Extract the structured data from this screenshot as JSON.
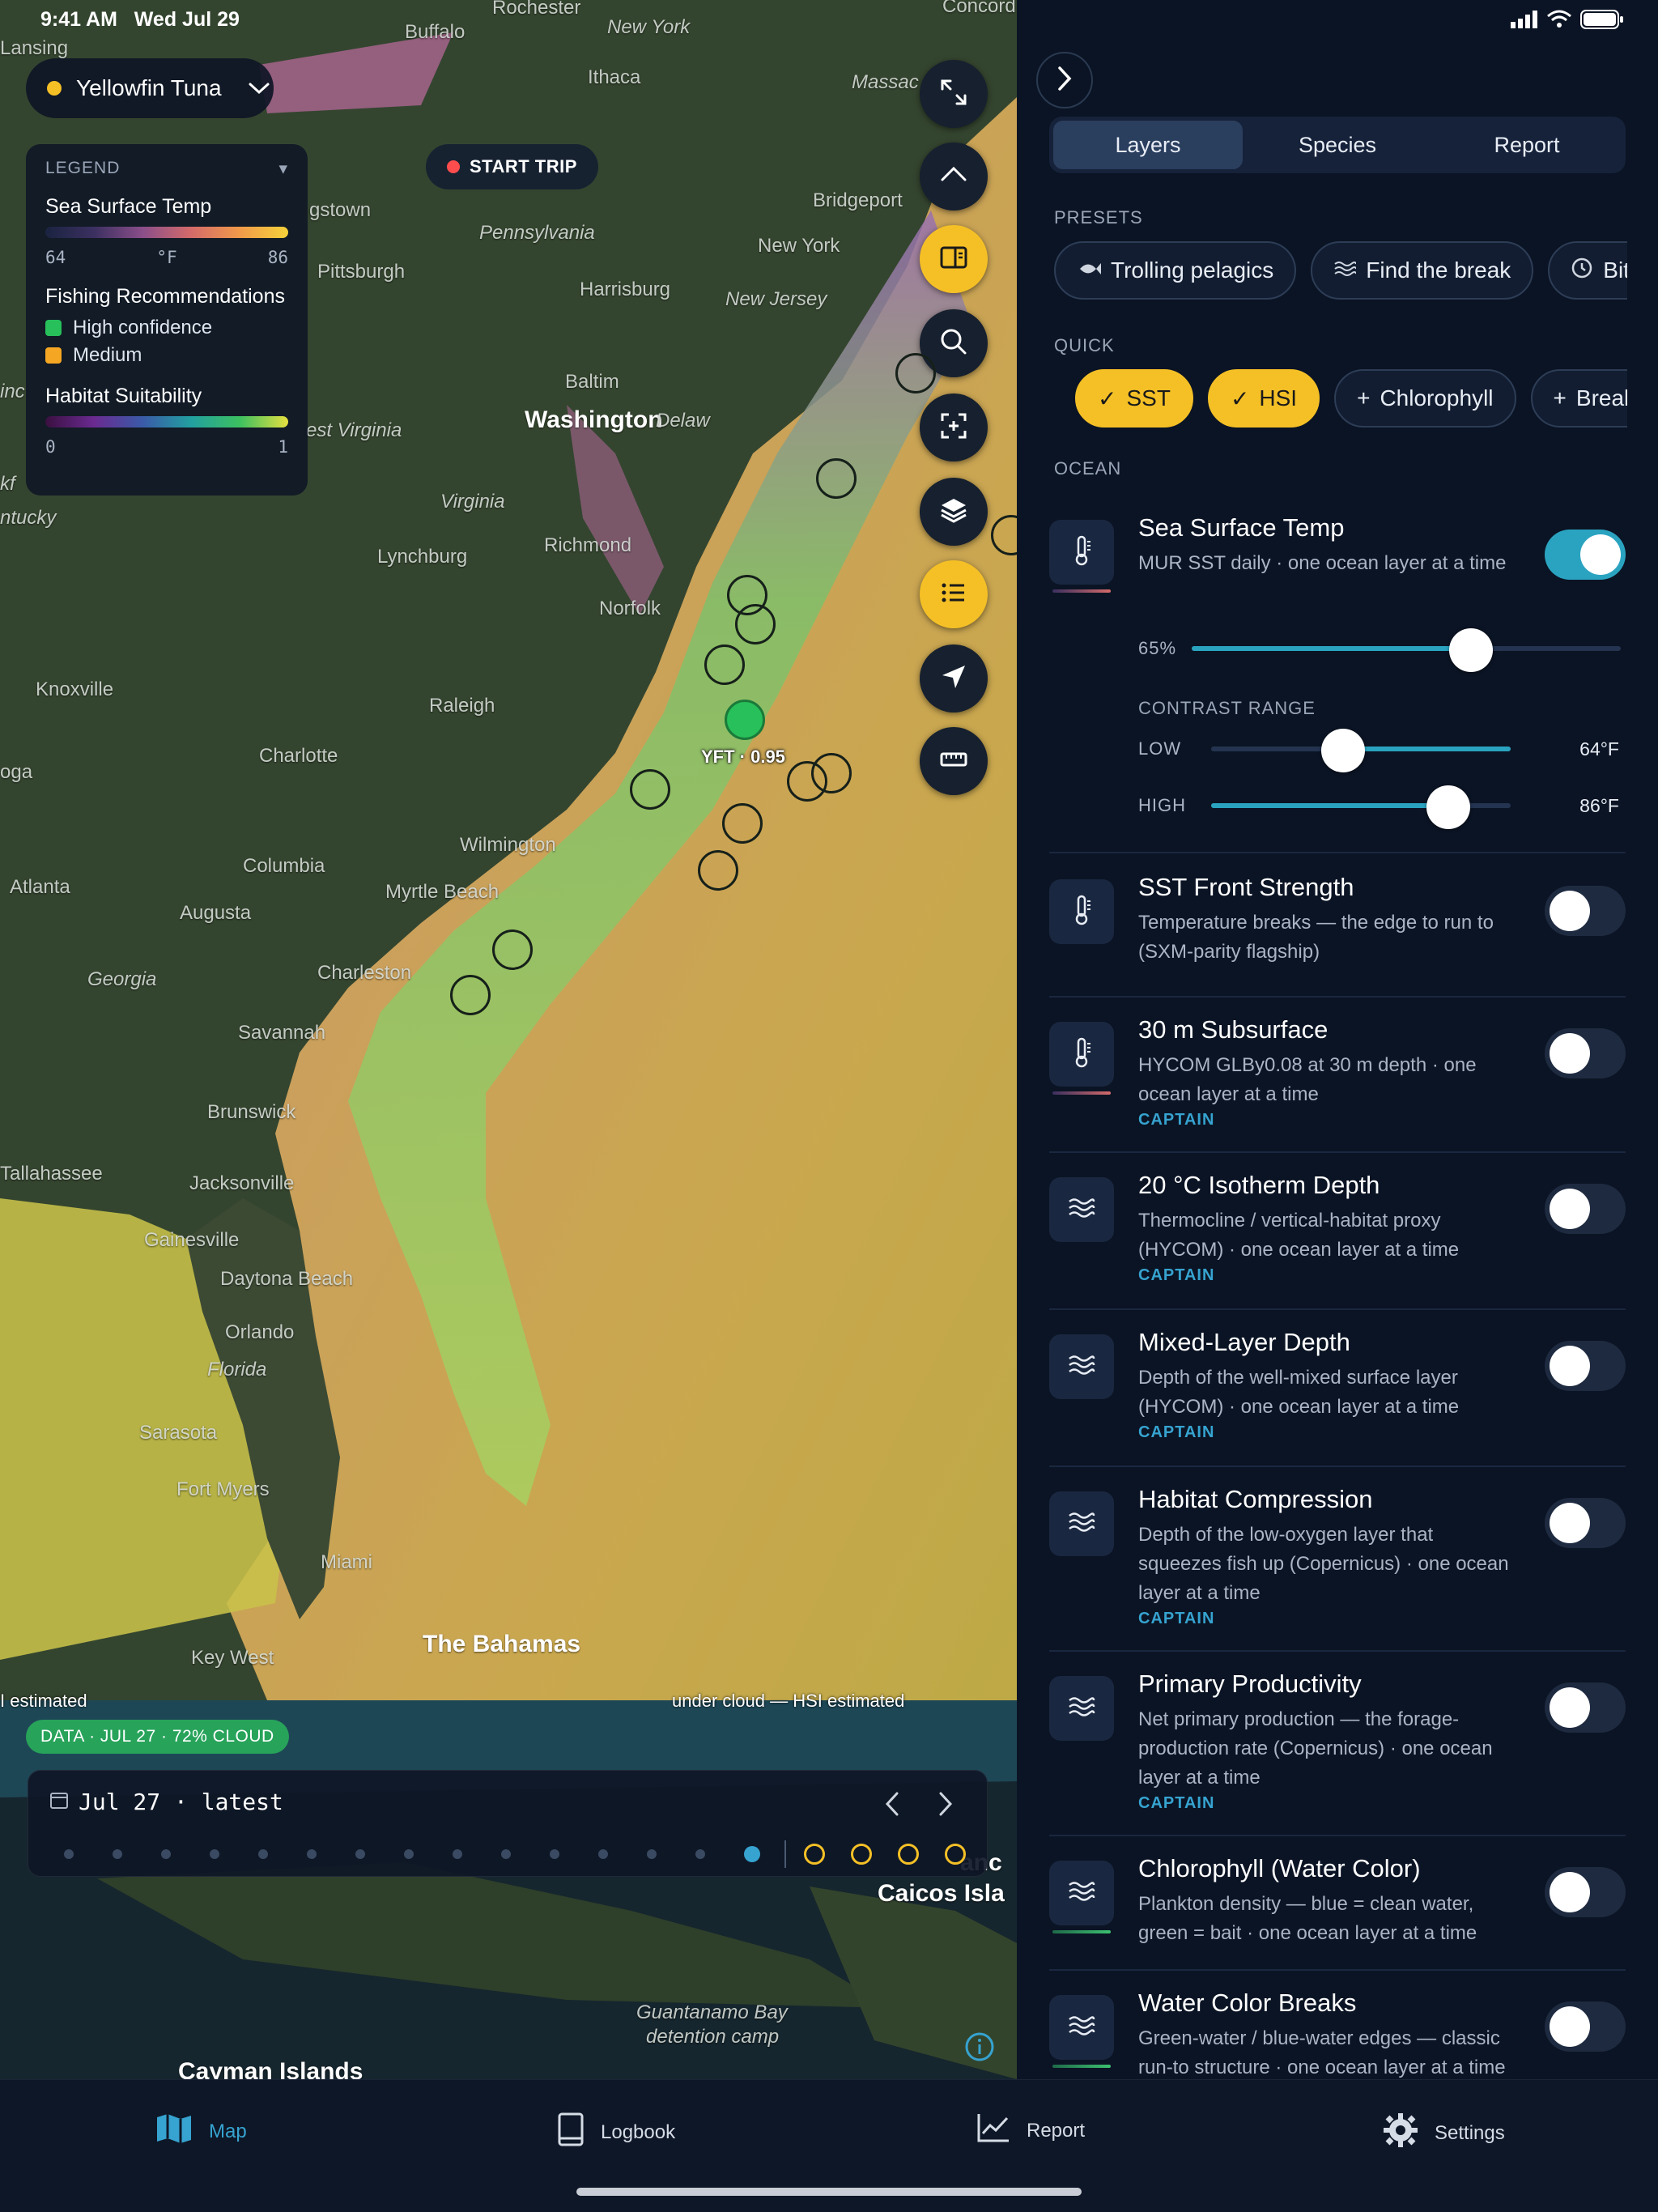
{
  "status_bar": {
    "time": "9:41 AM",
    "date": "Wed Jul 29"
  },
  "map": {
    "species_selector": {
      "label": "Yellowfin Tuna",
      "dot_color": "#f5c026"
    },
    "start_trip_label": "START TRIP",
    "legend": {
      "title": "LEGEND",
      "sst": {
        "heading": "Sea Surface Temp",
        "min": "64",
        "unit": "°F",
        "max": "86"
      },
      "recommendations": {
        "heading": "Fishing Recommendations",
        "high": "High confidence",
        "medium": "Medium",
        "high_color": "#27c05a",
        "medium_color": "#f5a623"
      },
      "habitat": {
        "heading": "Habitat Suitability",
        "min": "0",
        "max": "1"
      }
    },
    "place_labels": {
      "rochester": "Rochester",
      "buffalo": "Buffalo",
      "new_york": "New York",
      "concord": "Concord",
      "lansing": "Lansing",
      "ithaca": "Ithaca",
      "massachusetts": "Massac",
      "gstown": "gstown",
      "pennsylvania": "Pennsylvania",
      "bridgeport": "Bridgeport",
      "pittsburgh": "Pittsburgh",
      "harrisburg": "Harrisburg",
      "new_york_city": "New York",
      "new_jersey": "New Jersey",
      "baltimore": "Baltim",
      "washington": "Washington",
      "delaware": "Delaw",
      "west_virginia": "est Virginia",
      "kf": "kf",
      "virginia": "Virginia",
      "richmond": "Richmond",
      "lynchburg": "Lynchburg",
      "ntucky": "ntucky",
      "norfolk": "Norfolk",
      "knoxville": "Knoxville",
      "raleigh": "Raleigh",
      "charlotte": "Charlotte",
      "oga": "oga",
      "wilmington": "Wilmington",
      "columbia": "Columbia",
      "atlanta": "Atlanta",
      "myrtle_beach": "Myrtle Beach",
      "augusta": "Augusta",
      "georgia": "Georgia",
      "charleston": "Charleston",
      "savannah": "Savannah",
      "brunswick": "Brunswick",
      "tallahassee": "Tallahassee",
      "jacksonville": "Jacksonville",
      "gainesville": "Gainesville",
      "daytona_beach": "Daytona Beach",
      "orlando": "Orlando",
      "florida": "Florida",
      "sarasota": "Sarasota",
      "fort_myers": "Fort Myers",
      "miami": "Miami",
      "key_west": "Key West",
      "bahamas": "The Bahamas",
      "caicos": "Caicos Isla",
      "turks": "anc",
      "guantanamo": "Guantanamo Bay",
      "detention": "detention camp",
      "cayman": "Cayman Islands",
      "inc": "inc"
    },
    "marker_label": "YFT · 0.95",
    "attribution_left": "I estimated",
    "attribution_right": "under cloud — HSI estimated",
    "data_badge": "DATA · JUL 27 · 72% CLOUD",
    "timeline": {
      "date_label": "Jul 27 · latest",
      "past_days": 14,
      "forecast_days": 4
    }
  },
  "panel": {
    "tabs": [
      {
        "label": "Layers",
        "active": true
      },
      {
        "label": "Species",
        "active": false
      },
      {
        "label": "Report",
        "active": false
      }
    ],
    "presets": {
      "heading": "PRESETS",
      "items": [
        {
          "label": "Trolling pelagics",
          "icon": "fish-icon"
        },
        {
          "label": "Find the break",
          "icon": "waves-icon"
        },
        {
          "label": "Bite t",
          "icon": "clock-icon"
        }
      ]
    },
    "quick": {
      "heading": "QUICK",
      "items": [
        {
          "label": "SST",
          "on": true
        },
        {
          "label": "HSI",
          "on": true
        },
        {
          "label": "Chlorophyll",
          "on": false
        },
        {
          "label": "Breaks",
          "on": false
        }
      ]
    },
    "ocean": {
      "heading": "OCEAN",
      "sst": {
        "title": "Sea Surface Temp",
        "desc": "MUR SST daily  ·  one ocean layer at a time",
        "on": true,
        "opacity_label": "65%",
        "opacity": 0.65,
        "contrast_heading": "CONTRAST RANGE",
        "low_label": "LOW",
        "low_value": "64°F",
        "high_label": "HIGH",
        "high_value": "86°F"
      },
      "layers": [
        {
          "title": "SST Front Strength",
          "desc": "Temperature breaks — the edge to run to (SXM-parity flagship)",
          "cap": "",
          "icon": "thermometer-icon",
          "on": false
        },
        {
          "title": "30 m Subsurface",
          "desc": "HYCOM GLBy0.08 at 30 m depth  ·  one ocean layer at a time",
          "cap": "CAPTAIN",
          "icon": "thermometer-icon",
          "on": false
        },
        {
          "title": "20 °C Isotherm Depth",
          "desc": "Thermocline / vertical-habitat proxy (HYCOM)  ·  one ocean layer at a time",
          "cap": "CAPTAIN",
          "icon": "waves-icon",
          "on": false
        },
        {
          "title": "Mixed-Layer Depth",
          "desc": "Depth of the well-mixed surface layer (HYCOM)  ·  one ocean layer at a time",
          "cap": "CAPTAIN",
          "icon": "waves-icon",
          "on": false
        },
        {
          "title": "Habitat Compression",
          "desc": "Depth of the low-oxygen layer that squeezes fish up (Copernicus)  ·  one ocean layer at a time",
          "cap": "CAPTAIN",
          "icon": "waves-icon",
          "on": false
        },
        {
          "title": "Primary Productivity",
          "desc": "Net primary production — the forage-production rate (Copernicus)  ·  one ocean layer at a time",
          "cap": "CAPTAIN",
          "icon": "waves-icon",
          "on": false
        },
        {
          "title": "Chlorophyll (Water Color)",
          "desc": "Plankton density — blue = clean water, green = bait  ·  one ocean layer at a time",
          "cap": "",
          "icon": "waves-icon",
          "on": false
        },
        {
          "title": "Water Color Breaks",
          "desc": "Green-water / blue-water edges — classic run-to structure  ·  one ocean layer at a time",
          "cap": "",
          "icon": "waves-icon",
          "on": false
        }
      ]
    }
  },
  "tabbar": {
    "items": [
      {
        "label": "Map",
        "icon": "map-icon",
        "active": true
      },
      {
        "label": "Logbook",
        "icon": "book-icon",
        "active": false
      },
      {
        "label": "Report",
        "icon": "chart-icon",
        "active": false
      },
      {
        "label": "Settings",
        "icon": "gear-icon",
        "active": false
      }
    ]
  },
  "colors": {
    "accent": "#36a3d0",
    "yellow": "#f5c026",
    "toggle_on": "#2aa3c0",
    "panel_bg": "#0b1424"
  }
}
